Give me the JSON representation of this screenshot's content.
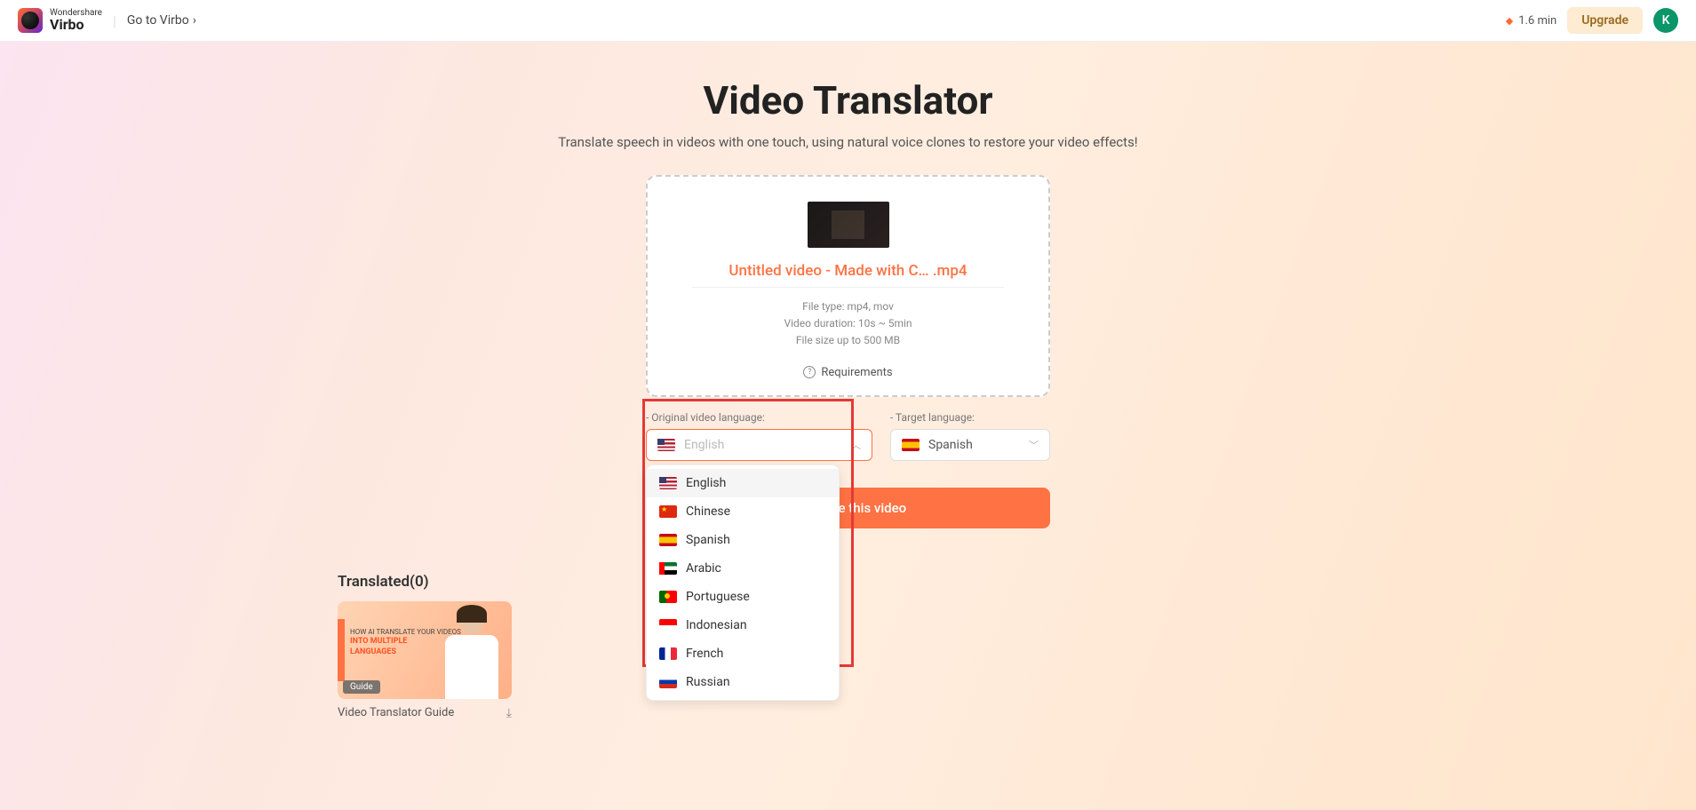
{
  "header": {
    "brand_top": "Wondershare",
    "brand_bottom": "Virbo",
    "go_link": "Go to Virbo",
    "credits": "1.6 min",
    "upgrade": "Upgrade",
    "avatar_initial": "K"
  },
  "page": {
    "title": "Video Translator",
    "subtitle": "Translate speech in videos with one touch, using natural voice clones to restore your video effects!"
  },
  "upload": {
    "filename": "Untitled video - Made with C… .mp4",
    "info_type": "File type: mp4, mov",
    "info_duration": "Video duration: 10s ~ 5min",
    "info_size": "File size up to 500 MB",
    "requirements": "Requirements"
  },
  "lang": {
    "original_label": "- Original video language:",
    "original_placeholder": "English",
    "target_label": "- Target language:",
    "target_value": "Spanish",
    "options": [
      {
        "name": "English",
        "flag": "us"
      },
      {
        "name": "Chinese",
        "flag": "cn"
      },
      {
        "name": "Spanish",
        "flag": "es"
      },
      {
        "name": "Arabic",
        "flag": "ae"
      },
      {
        "name": "Portuguese",
        "flag": "pt"
      },
      {
        "name": "Indonesian",
        "flag": "id"
      },
      {
        "name": "French",
        "flag": "fr"
      },
      {
        "name": "Russian",
        "flag": "ru"
      }
    ]
  },
  "cta": "Translate this video",
  "translated": {
    "heading": "Translated(0)",
    "guide_badge": "Guide",
    "guide_thumb_line1": "HOW AI TRANSLATE YOUR VIDEOS",
    "guide_thumb_line2": "INTO MULTIPLE",
    "guide_thumb_line3": "LANGUAGES",
    "guide_title": "Video Translator Guide"
  }
}
